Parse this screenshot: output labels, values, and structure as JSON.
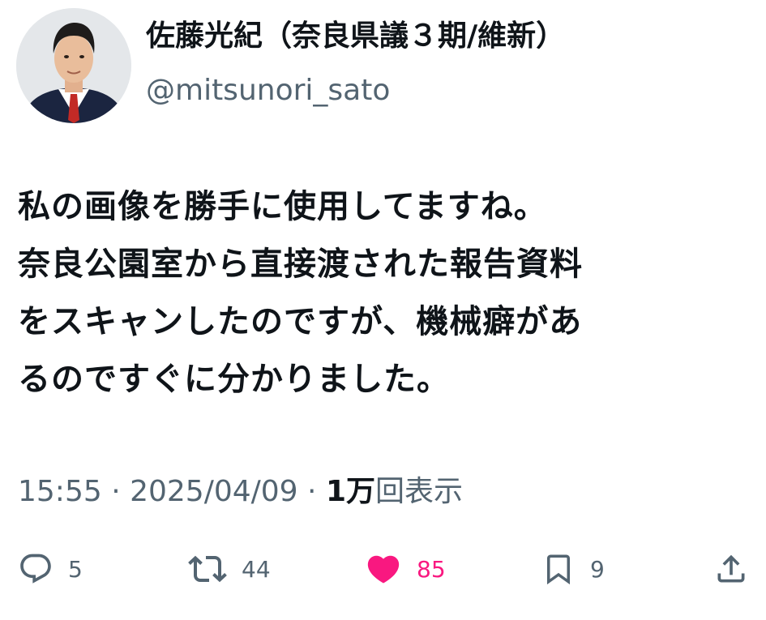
{
  "author": {
    "display_name": "佐藤光紀（奈良県議３期/維新）",
    "handle": "@mitsunori_sato"
  },
  "tweet": {
    "lines": [
      "私の画像を勝手に使用してますね。",
      "奈良公園室から直接渡された報告資料",
      "をスキャンしたのですが、機械癖があ",
      "るのですぐに分かりました。"
    ]
  },
  "meta": {
    "time": "15:55",
    "separator": " · ",
    "date": "2025/04/09",
    "views_count": "1万",
    "views_label": "回表示"
  },
  "actions": {
    "replies": "5",
    "reposts": "44",
    "likes": "85",
    "bookmarks": "9"
  },
  "colors": {
    "text": "#0f1419",
    "secondary": "#536471",
    "like": "#f91880"
  }
}
